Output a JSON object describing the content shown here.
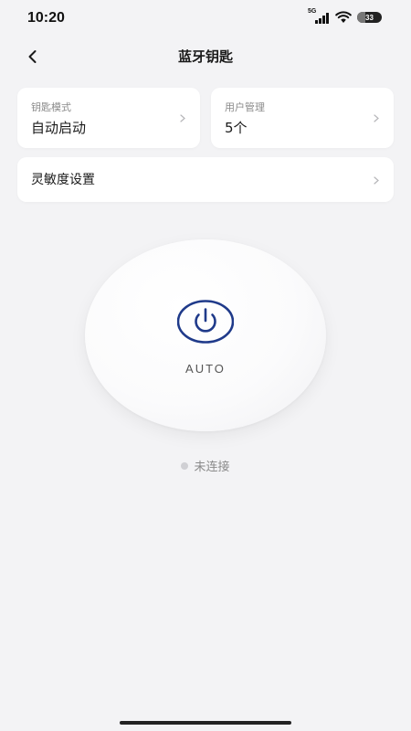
{
  "status_bar": {
    "time": "10:20",
    "network": "5G",
    "battery_level": "33",
    "battery_fraction": 0.33
  },
  "nav": {
    "title": "蓝牙钥匙",
    "back_icon": "chevron-left-icon"
  },
  "cards": {
    "key_mode": {
      "label": "钥匙模式",
      "value": "自动启动"
    },
    "user_management": {
      "label": "用户管理",
      "value": "5个"
    },
    "sensitivity": {
      "label": "灵敏度设置"
    }
  },
  "power": {
    "mode_text": "AUTO",
    "icon": "power-icon",
    "icon_color": "#1f3a8a"
  },
  "connection": {
    "status_text": "未连接",
    "dot_color": "#d0d0d4"
  },
  "colors": {
    "background": "#f3f3f5",
    "card": "#ffffff",
    "accent": "#1f3a8a"
  }
}
